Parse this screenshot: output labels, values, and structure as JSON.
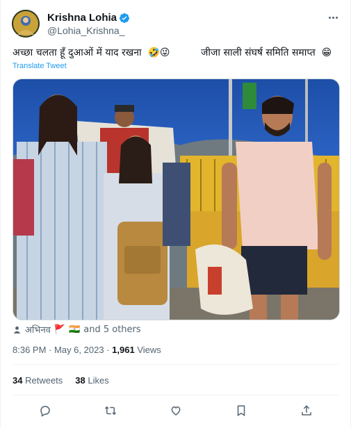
{
  "author": {
    "display_name": "Krishna Lohia",
    "handle": "@Lohia_Krishna_",
    "verified": true
  },
  "tweet": {
    "text": "अच्छा चलता हूँ दुआओं में याद रखना  🤣😜          जीजा साली संघर्ष समिति समाप्त  😁",
    "translate_label": "Translate Tweet"
  },
  "tagged": {
    "first_person": "अभिनव",
    "flags": [
      "🚩",
      "🇮🇳"
    ],
    "others_label": "and 5 others"
  },
  "meta": {
    "time": "8:36 PM",
    "separator": "·",
    "date": "May 6, 2023",
    "views_count": "1,961",
    "views_label": "Views"
  },
  "stats": {
    "retweets_count": "34",
    "retweets_label": "Retweets",
    "likes_count": "38",
    "likes_label": "Likes"
  },
  "icons": {
    "verified": "verified-badge-icon",
    "more": "more-options-icon",
    "reply": "reply-icon",
    "retweet": "retweet-icon",
    "like": "heart-icon",
    "bookmark": "bookmark-icon",
    "share": "share-icon"
  },
  "colors": {
    "accent": "#1d9bf0",
    "muted": "#536471",
    "text": "#0f1419"
  }
}
